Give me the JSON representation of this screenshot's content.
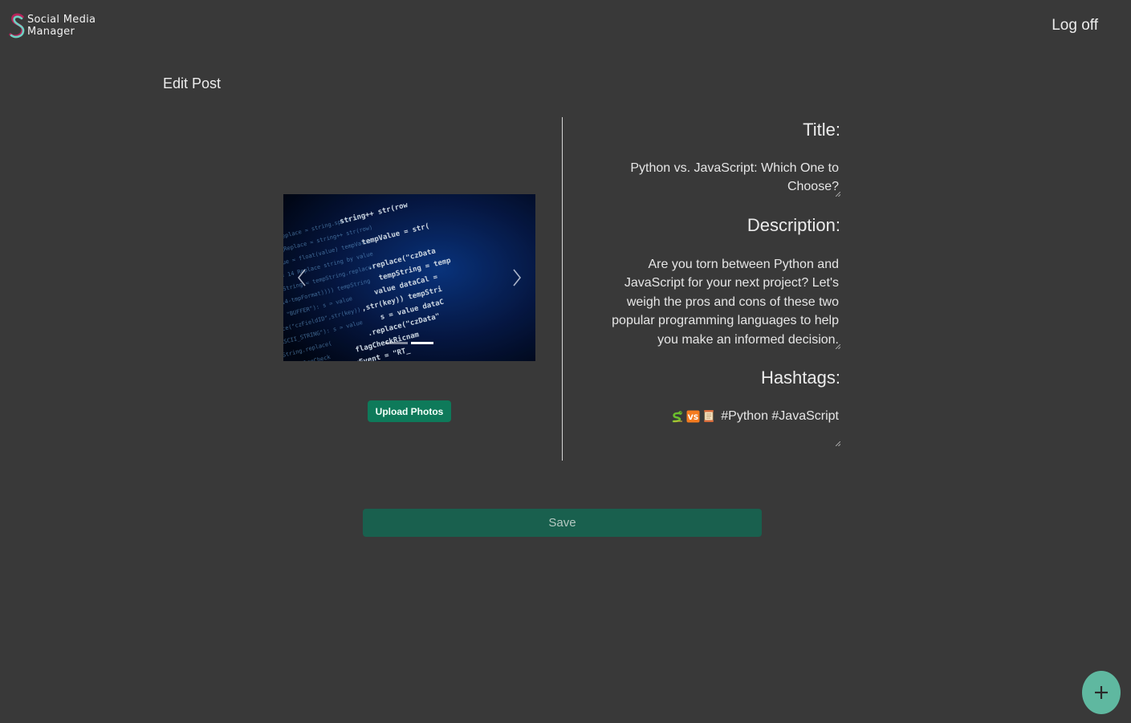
{
  "app": {
    "name_line1": "Social Media",
    "name_line2": "Manager",
    "logout_label": "Log off"
  },
  "page": {
    "title": "Edit Post"
  },
  "media": {
    "carousel_prev_icon": "chevron-left-icon",
    "carousel_next_icon": "chevron-right-icon",
    "slide_count": 2,
    "active_slide": 2,
    "upload_label": "Upload Photos"
  },
  "form": {
    "title_label": "Title:",
    "title_value_line1": "Python vs. JavaScript: Which One to",
    "title_value_line2": "Choose?",
    "description_label": "Description:",
    "description_lines": [
      "Are you torn between Python and",
      "JavaScript for your next project? Let's",
      "weigh the pros and cons of these two",
      "popular programming languages to help",
      "you make an informed decision."
    ],
    "hashtags_label": "Hashtags:",
    "hashtags_emojis": [
      "snake-icon",
      "vs-icon",
      "scroll-icon"
    ],
    "hashtags_text": "#Python #JavaScript",
    "save_label": "Save"
  },
  "fab": {
    "icon": "plus-icon"
  },
  "colors": {
    "background": "#393939",
    "upload_button": "#0e7a5a",
    "save_button": "#19604e",
    "fab": "#5fb8a0"
  }
}
